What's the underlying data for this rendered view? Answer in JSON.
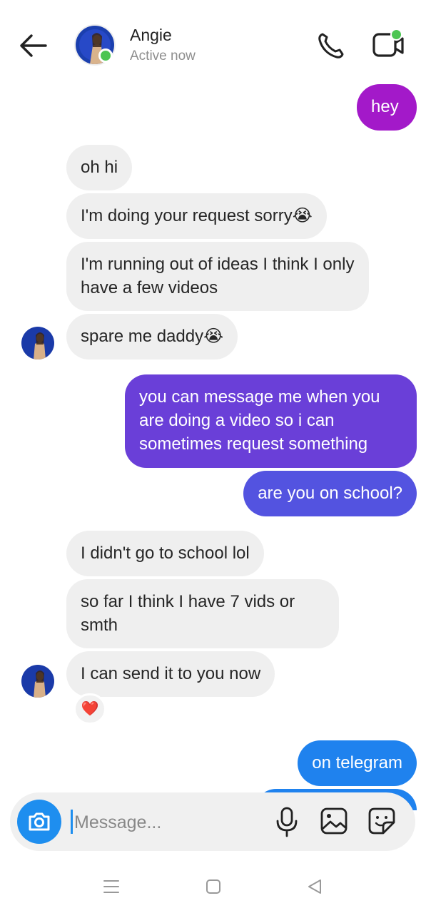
{
  "header": {
    "contact_name": "Angie",
    "status": "Active now",
    "icons": {
      "back": "back-arrow-icon",
      "call": "phone-icon",
      "video": "video-call-icon"
    },
    "online_color": "#4cc552"
  },
  "messages": {
    "m1": "hey",
    "m2": "oh hi",
    "m3": "I'm doing your request sorry😭",
    "m4": "I'm running out of ideas I think I only have a few videos",
    "m5": "spare me daddy😭",
    "m6": "you can message me when you are doing a video so i can sometimes request something",
    "m7": "are you on school?",
    "m8": "I didn't go to school lol",
    "m9": "so far I think I have 7 vids or smth",
    "m10": "I can send it to you now",
    "m11": "on telegram"
  },
  "reaction": "❤️",
  "colors": {
    "incoming_bubble": "#efefef",
    "outgoing_purple": "#a319c9",
    "outgoing_violet": "#6a3fd8",
    "outgoing_indigo": "#5353e0",
    "outgoing_blue": "#1f82ee",
    "accent": "#1e8eef"
  },
  "composer": {
    "placeholder": "Message...",
    "icons": {
      "camera": "camera-icon",
      "mic": "microphone-icon",
      "gallery": "gallery-icon",
      "sticker": "sticker-icon"
    }
  },
  "navbar": {
    "icons": [
      "menu-icon",
      "home-icon",
      "back-icon"
    ]
  }
}
